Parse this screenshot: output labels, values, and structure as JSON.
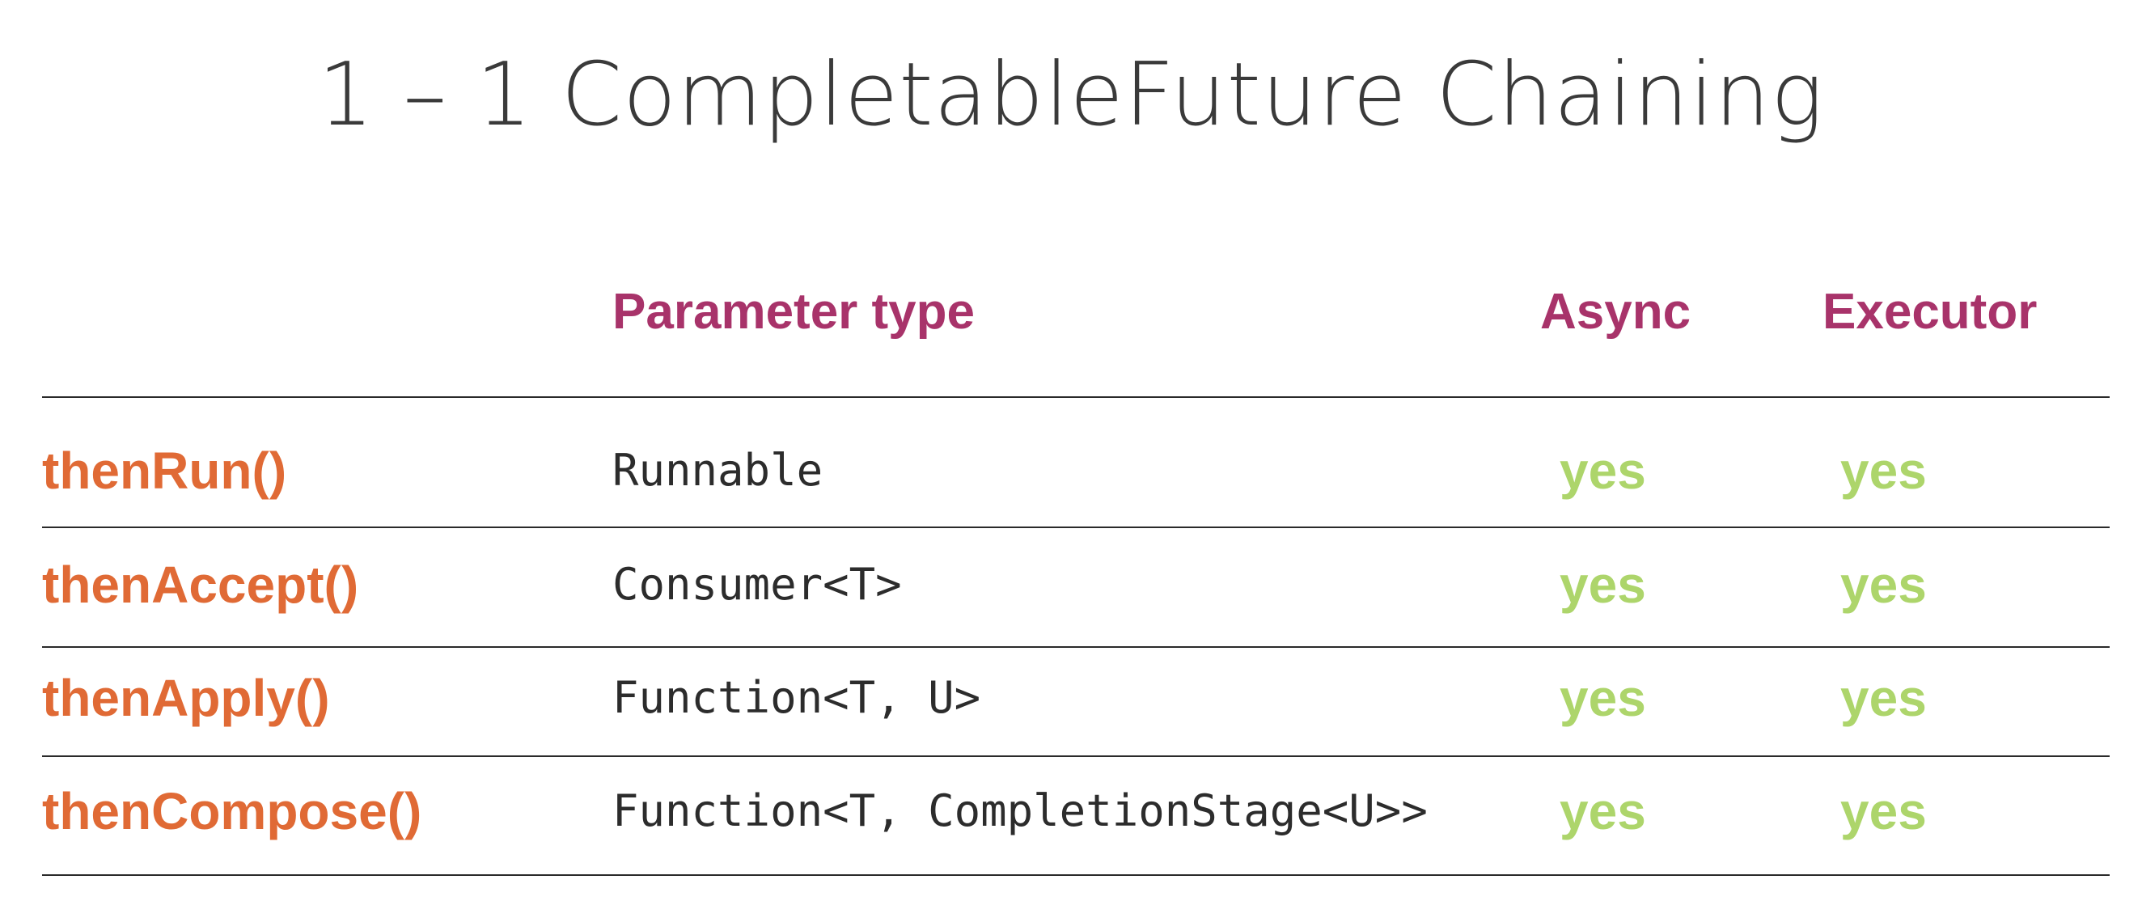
{
  "slide": {
    "title": "1 – 1 CompletableFuture Chaining"
  },
  "table": {
    "headers": {
      "parameter_type": "Parameter type",
      "async": "Async",
      "executor": "Executor"
    },
    "rows": [
      {
        "method": "thenRun()",
        "parameter_type": "Runnable",
        "async": "yes",
        "executor": "yes"
      },
      {
        "method": "thenAccept()",
        "parameter_type": "Consumer<T>",
        "async": "yes",
        "executor": "yes"
      },
      {
        "method": "thenApply()",
        "parameter_type": "Function<T, U>",
        "async": "yes",
        "executor": "yes"
      },
      {
        "method": "thenCompose()",
        "parameter_type": "Function<T, CompletionStage<U>>",
        "async": "yes",
        "executor": "yes"
      }
    ]
  },
  "colors": {
    "background": "#ffffff",
    "title": "#3a3a3a",
    "header": "#a8336a",
    "method": "#e06a35",
    "flag": "#add56b",
    "rule": "#2a2a2a"
  }
}
